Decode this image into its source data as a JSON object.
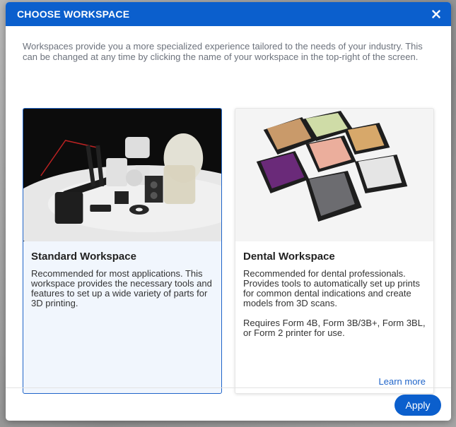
{
  "dialog": {
    "title": "CHOOSE WORKSPACE",
    "intro": "Workspaces provide you a more specialized experience tailored to the needs of your industry. This can be changed at any time by clicking the name of your workspace in the top-right of the screen."
  },
  "cards": [
    {
      "title": "Standard Workspace",
      "description": "Recommended for most applications. This workspace provides the necessary tools and features to set up a wide variety of parts for 3D printing.",
      "selected": true
    },
    {
      "title": "Dental Workspace",
      "description": "Recommended for dental professionals. Provides tools to automatically set up prints for common dental indications and create models from 3D scans.",
      "requirements": "Requires Form 4B, Form 3B/3B+, Form 3BL, or Form 2 printer for use.",
      "link": "Learn more",
      "selected": false
    }
  ],
  "footer": {
    "apply_label": "Apply"
  },
  "icons": {
    "close": "close-icon"
  },
  "colors": {
    "accent": "#0b5fcd",
    "selected_bg": "#f1f6fd",
    "link": "#1f64c9"
  }
}
